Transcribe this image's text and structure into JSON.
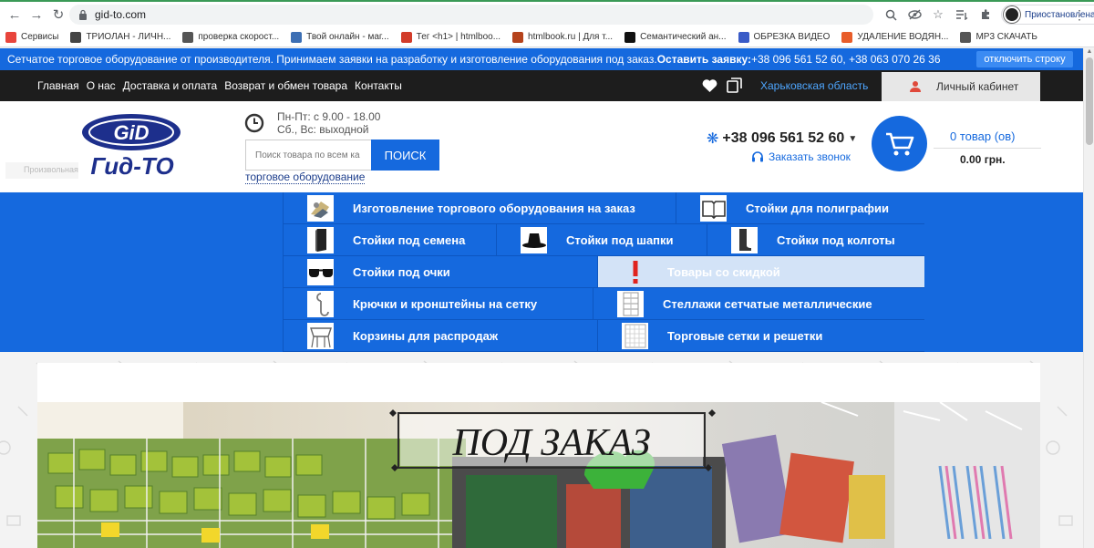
{
  "browser": {
    "url": "gid-to.com",
    "profile_label": "Приостановлена",
    "bookmarks": [
      {
        "label": "Сервисы",
        "color": "#e8453c"
      },
      {
        "label": "ТРИОЛАН - ЛИЧН...",
        "color": "#444444"
      },
      {
        "label": "проверка скорост...",
        "color": "#555555"
      },
      {
        "label": "Твой онлайн - маг...",
        "color": "#3d6fb4"
      },
      {
        "label": "Тег <h1> | htmlboo...",
        "color": "#d23c2a"
      },
      {
        "label": "htmlbook.ru | Для т...",
        "color": "#b5431c"
      },
      {
        "label": "Семантический ан...",
        "color": "#111111"
      },
      {
        "label": "ОБРЕЗКА ВИДЕО",
        "color": "#3a5bc7"
      },
      {
        "label": "УДАЛЕНИЕ ВОДЯН...",
        "color": "#e85d2a"
      },
      {
        "label": "MP3 СКАЧАТЬ",
        "color": "#555555"
      }
    ]
  },
  "promo": {
    "text": "Сетчатое торговое оборудование от производителя. Принимаем заявки на разработку и изготовление оборудования под заказ.",
    "cta": "Оставить заявку:",
    "phones": " +38 096 561 52 60, +38 063 070 26 36",
    "button": "отключить строку"
  },
  "nav": {
    "links": [
      "Главная",
      "О нас",
      "Доставка и оплата",
      "Возврат и обмен товара",
      "Контакты"
    ],
    "region": "Харьковская область",
    "cabinet": "Личный кабинет"
  },
  "header": {
    "logo_text": "Гид-ТО",
    "logo_mark": "GiD",
    "ghost_label": "Произвольная",
    "hours_line1": "Пн-Пт: с 9.00 - 18.00",
    "hours_line2": "Сб., Вс: выходной",
    "search_placeholder": "Поиск товара по всем ка",
    "search_button": "ПОИСК",
    "search_hint": "торговое оборудование",
    "phone": "+38 096 561 52 60",
    "callback": "Заказать звонок",
    "cart_count": "0 товар (ов)",
    "cart_total": "0.00 грн."
  },
  "menu": {
    "rows": [
      [
        {
          "label": "Изготовление торгового оборудования на заказ"
        },
        {
          "label": "Стойки для полиграфии"
        }
      ],
      [
        {
          "label": "Стойки под семена"
        },
        {
          "label": "Стойки под шапки"
        },
        {
          "label": "Стойки под колготы"
        }
      ],
      [
        {
          "label": "Стойки под очки"
        },
        {
          "label": "Товары со скидкой"
        }
      ],
      [
        {
          "label": "Крючки и кронштейны на сетку"
        },
        {
          "label": "Стеллажи сетчатые металлические"
        }
      ],
      [
        {
          "label": "Корзины для распродаж"
        },
        {
          "label": "Торговые сетки и решетки"
        }
      ]
    ]
  },
  "banner": {
    "title": "ПОД ЗАКАЗ"
  },
  "colors": {
    "brand_blue": "#1569de",
    "nav_dark": "#1d1d1d",
    "logo_navy": "#1d2f8c"
  }
}
